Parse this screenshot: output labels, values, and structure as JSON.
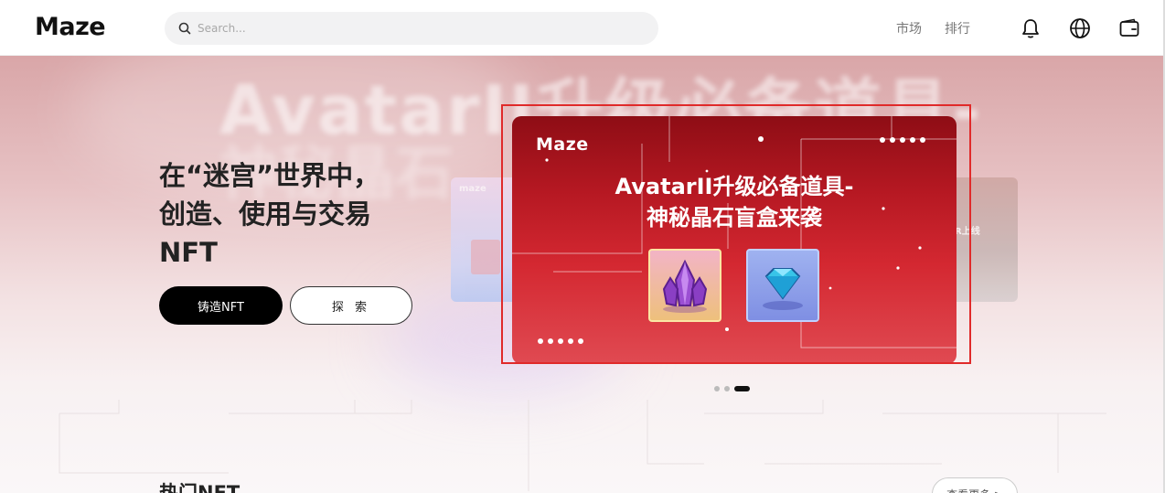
{
  "header": {
    "logo": "Maze",
    "search_placeholder": "Search...",
    "nav": [
      {
        "label": "市场"
      },
      {
        "label": "排行"
      }
    ],
    "icons": [
      "bell-icon",
      "globe-icon",
      "wallet-icon"
    ]
  },
  "hero": {
    "bg_text_line1": "AvatarII升级必备道具-",
    "bg_text_line2": "神秘晶石",
    "headline": [
      "在“迷宫”世界中，",
      "创造、使用与交易",
      "NFT"
    ],
    "mint_button": "铸造NFT",
    "explore_button": "探 索"
  },
  "banner": {
    "logo": "Maze",
    "title_line1": "AvatarII升级必备道具-",
    "title_line2": "神秘晶石盲盒来袭",
    "highlight_color": "#e02a2a",
    "items": [
      {
        "name": "purple-crystal"
      },
      {
        "name": "blue-diamond"
      }
    ]
  },
  "side_cards": {
    "left_logo": "maze",
    "right_text": "R上线"
  },
  "carousel": {
    "count": 3,
    "active_index": 2
  },
  "hot_section": {
    "title": "热门NFT",
    "see_more": "查看更多 >"
  },
  "colors": {
    "accent": "#000000",
    "banner_red": "#c81f28"
  }
}
